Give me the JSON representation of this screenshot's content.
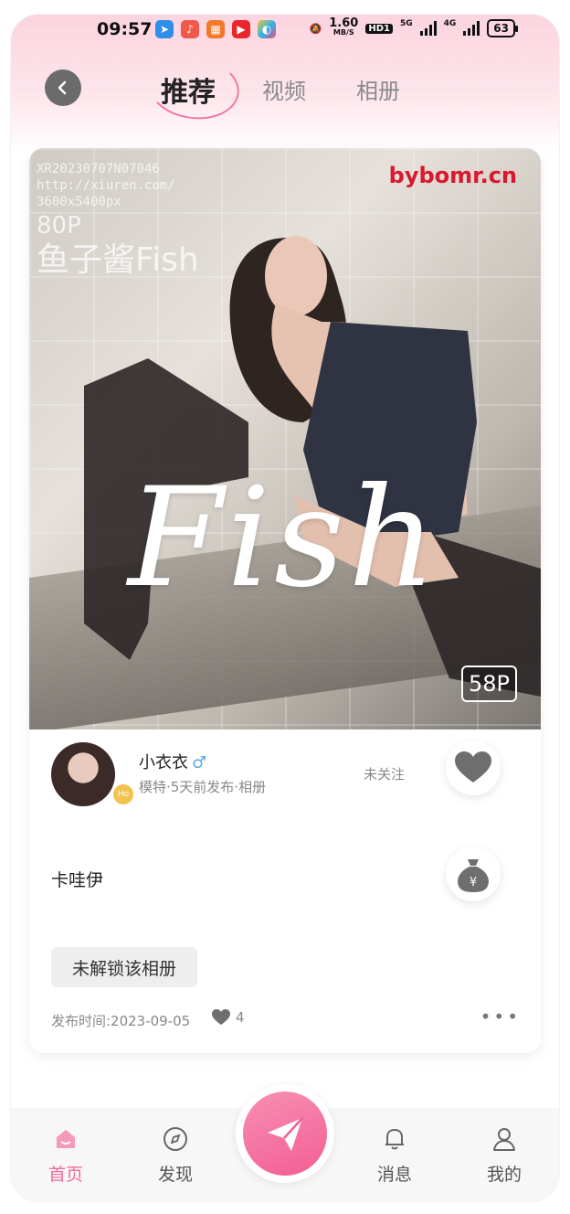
{
  "status_bar": {
    "time": "09:57",
    "net_speed_value": "1.60",
    "net_speed_unit": "MB/S",
    "hd_badge": "HD1",
    "signal1_label": "5G",
    "signal2_label": "4G",
    "battery": "63"
  },
  "header": {
    "tabs": [
      {
        "label": "推荐",
        "active": true
      },
      {
        "label": "视频",
        "active": false
      },
      {
        "label": "相册",
        "active": false
      }
    ]
  },
  "post": {
    "watermark": {
      "code": "XR20230707N07046",
      "url": "http://xiuren.com/",
      "size": "3600x5400px",
      "count": "80P",
      "name": "鱼子酱Fish",
      "site": "bybomr.cn",
      "script": "Fish"
    },
    "photo_count": "58P",
    "author": {
      "name": "小衣衣",
      "gender_icon": "♂",
      "level_badge": "Ho",
      "subtitle": "模特·5天前发布·相册"
    },
    "follow_status": "未关注",
    "description": "卡哇伊",
    "unlock_label": "未解锁该相册",
    "publish_time": "发布时间:2023-09-05",
    "like_count": "4",
    "more_label": "•••"
  },
  "tabbar": {
    "items": [
      {
        "label": "首页",
        "icon": "home-icon",
        "active": true
      },
      {
        "label": "发现",
        "icon": "compass-icon",
        "active": false
      },
      {
        "label": "消息",
        "icon": "bell-icon",
        "active": false
      },
      {
        "label": "我的",
        "icon": "user-icon",
        "active": false
      }
    ],
    "center_icon": "paper-plane-icon"
  },
  "colors": {
    "accent": "#f06b98",
    "header_gradient_top": "#fbd4df",
    "watermark_red": "#d8192e"
  }
}
